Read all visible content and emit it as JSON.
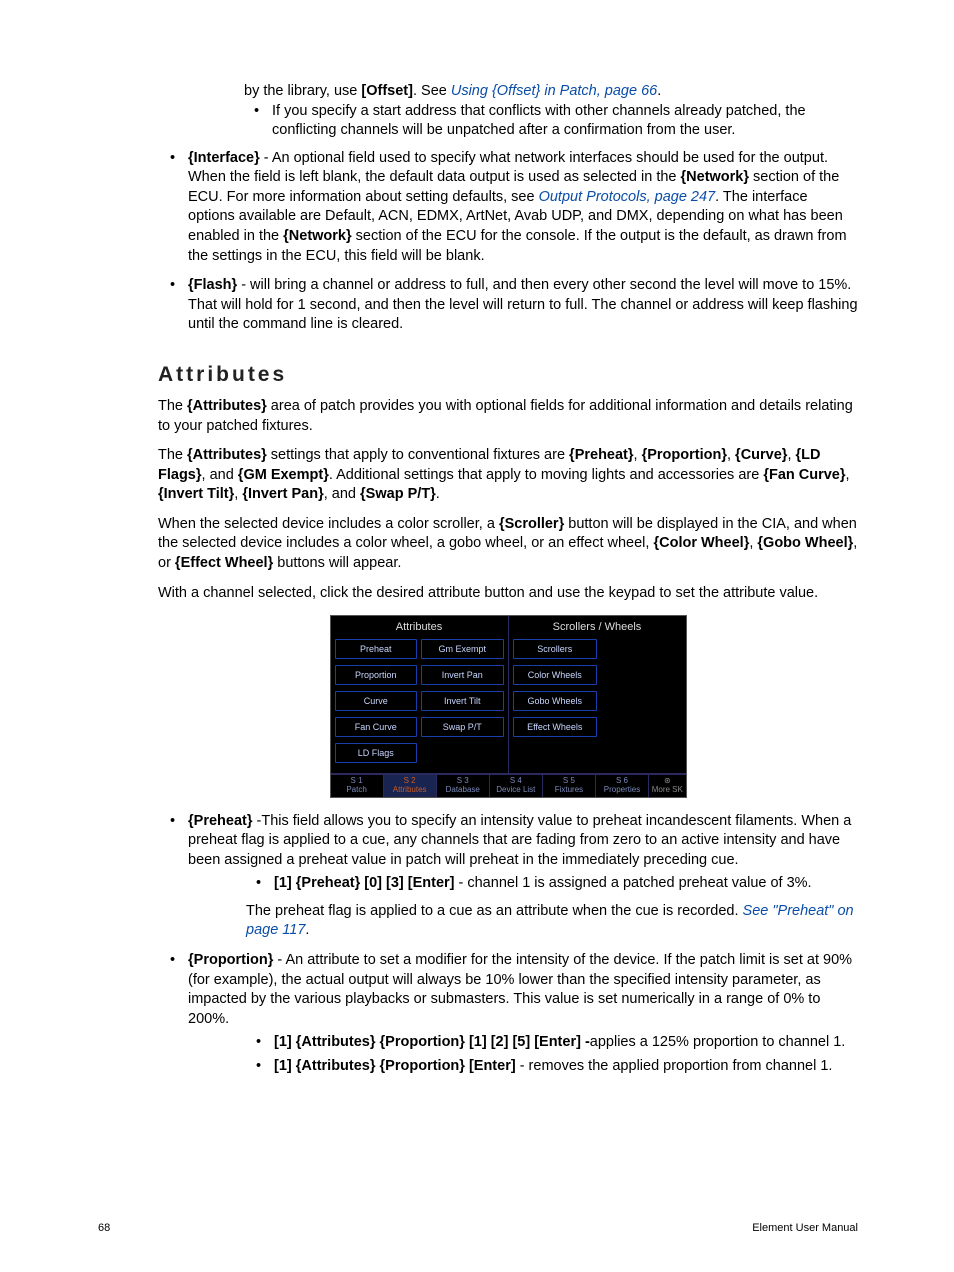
{
  "intro_list": {
    "item1_prefix": "by the library, use ",
    "item1_bold": "[Offset]",
    "item1_mid": ". See ",
    "item1_link": "Using {Offset} in Patch, page 66",
    "item1_end": ".",
    "item2": "If you specify a start address that conflicts with other channels already patched, the conflicting channels will be unpatched after a confirmation from the user."
  },
  "interface": {
    "label": "{Interface}",
    "t1": " - An optional field used to specify what network interfaces should be used for the output. When the field is left blank, the default data output is used as selected in the ",
    "b2": "{Network}",
    "t2": " section of the ECU. For more information about setting defaults, see ",
    "link": "Output Protocols, page 247",
    "t3": ". The interface options available are Default, ACN, EDMX, ArtNet, Avab UDP, and DMX, depending on what has been enabled in the ",
    "b3": "{Network}",
    "t4": " section of the ECU for the console. If the output is the default, as drawn from the settings in the ECU, this field will be blank."
  },
  "flash": {
    "label": "{Flash}",
    "text": " - will bring a channel or address to full, and then every other second the level will move to 15%. That will hold for 1 second, and then the level will return to full. The channel or address will keep flashing until the command line is cleared."
  },
  "attributes_heading": "Attributes",
  "attr_p1a": "The ",
  "attr_p1b": "{Attributes}",
  "attr_p1c": " area of patch provides you with optional fields for additional information and details relating to your patched fixtures.",
  "attr_p2": {
    "t1": "The ",
    "b1": "{Attributes}",
    "t2": " settings that apply to conventional fixtures are ",
    "b2": "{Preheat}",
    "c2": ", ",
    "b3": "{Proportion}",
    "c3": ", ",
    "b4": "{Curve}",
    "c4": ", ",
    "b5": "{LD Flags}",
    "c5": ", and ",
    "b6": "{GM Exempt}",
    "c6": ". Additional settings that apply to moving lights and accessories are ",
    "b7": "{Fan Curve}",
    "c7": ", ",
    "b8": "{Invert Tilt}",
    "c8": ", ",
    "b9": "{Invert Pan}",
    "c9": ", and ",
    "b10": "{Swap P/T}",
    "c10": "."
  },
  "attr_p3": {
    "t1": "When the selected device includes a color scroller, a ",
    "b1": "{Scroller}",
    "t2": " button will be displayed in the CIA, and when the selected device includes a color wheel, a gobo wheel, or an effect wheel, ",
    "b2": "{Color Wheel}",
    "c2": ", ",
    "b3": "{Gobo Wheel}",
    "c3": ", or ",
    "b4": "{Effect Wheel}",
    "t3": " buttons will appear."
  },
  "attr_p4": "With a channel selected, click the desired attribute button and use the keypad to set the attribute value.",
  "figure": {
    "col1_title": "Attributes",
    "col2_title": "Scrollers / Wheels",
    "col1": [
      [
        "Preheat",
        "Gm Exempt"
      ],
      [
        "Proportion",
        "Invert Pan"
      ],
      [
        "Curve",
        "Invert Tilt"
      ],
      [
        "Fan Curve",
        "Swap P/T"
      ],
      [
        "LD Flags",
        ""
      ]
    ],
    "col2": [
      [
        "Scrollers"
      ],
      [
        "Color Wheels"
      ],
      [
        "Gobo Wheels"
      ],
      [
        "Effect Wheels"
      ],
      [
        ""
      ]
    ],
    "tabs": [
      {
        "num": "S 1",
        "label": "Patch"
      },
      {
        "num": "S 2",
        "label": "Attributes",
        "active": true
      },
      {
        "num": "S 3",
        "label": "Database"
      },
      {
        "num": "S 4",
        "label": "Device List"
      },
      {
        "num": "S 5",
        "label": "Fixtures"
      },
      {
        "num": "S 6",
        "label": "Properties"
      },
      {
        "num": "",
        "label": "More SK",
        "more": true
      }
    ]
  },
  "preheat": {
    "label": "{Preheat}",
    "t1": " -This field allows you to specify an intensity value to preheat incandescent filaments. When a preheat flag is applied to a cue, any channels that are fading from zero to an active intensity and have been assigned a preheat value in patch will preheat in the immediately preceding cue.",
    "sub_bold": "[1] {Preheat} [0] [3] [Enter]",
    "sub_text": " - channel 1 is assigned a patched preheat value of 3%.",
    "p2a": "The preheat flag is applied to a cue as an attribute when the cue is recorded. ",
    "p2_link": "See \"Preheat\" on page 117",
    "p2b": "."
  },
  "proportion": {
    "label": "{Proportion}",
    "t1": " - An attribute to set a modifier for the intensity of the device. If the patch limit is set at 90% (for example), the actual output will always be 10% lower than the specified intensity parameter, as impacted by the various playbacks or submasters. This value is set numerically in a range of 0% to 200%.",
    "s1b": "[1] {Attributes} {Proportion} [1] [2] [5] [Enter] -",
    "s1t": "applies a 125% proportion to channel 1.",
    "s2b": "[1] {Attributes} {Proportion} [Enter]",
    "s2t": " - removes the applied proportion from channel 1."
  },
  "footer": {
    "page": "68",
    "title": "Element User Manual"
  }
}
